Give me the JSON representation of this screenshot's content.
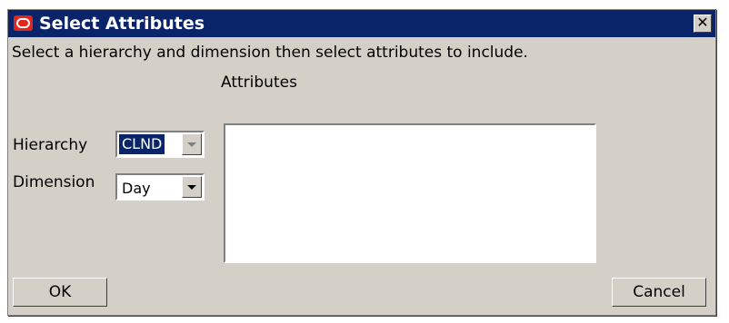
{
  "window": {
    "title": "Select Attributes",
    "close_glyph": "✕"
  },
  "instruction": "Select a hierarchy and dimension then select attributes to include.",
  "attributes_label": "Attributes",
  "hierarchy": {
    "label": "Hierarchy",
    "value": "CLND",
    "selected": true
  },
  "dimension": {
    "label": "Dimension",
    "value": "Day"
  },
  "attributes_items": [],
  "buttons": {
    "ok": "OK",
    "cancel": "Cancel"
  },
  "colors": {
    "titlebar": "#0a246a",
    "face": "#d4d0c8",
    "logo": "#e3251c"
  },
  "icons": {
    "app": "oracle-logo-icon",
    "close": "close-icon",
    "dropdown": "chevron-down-icon"
  }
}
